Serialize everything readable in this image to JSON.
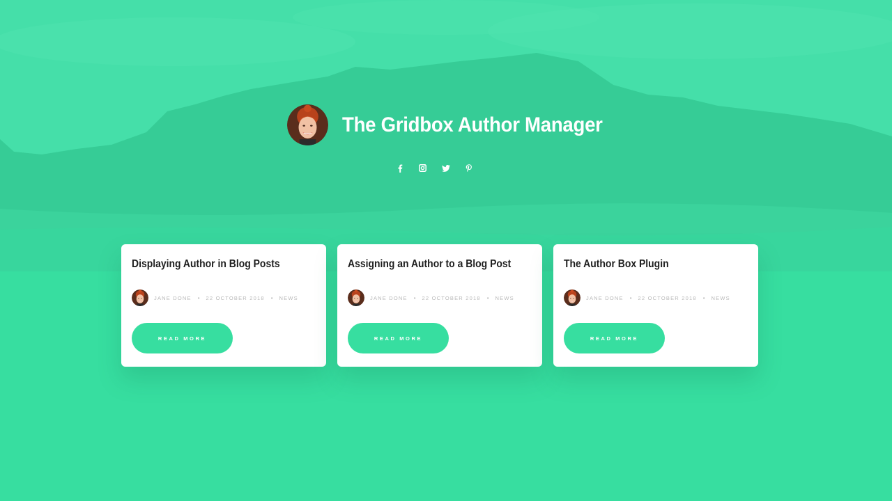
{
  "header": {
    "title": "The Gridbox Author Manager",
    "avatar": "author-avatar"
  },
  "socials": [
    {
      "icon": "facebook-icon",
      "glyph": "f"
    },
    {
      "icon": "instagram-icon"
    },
    {
      "icon": "twitter-icon"
    },
    {
      "icon": "pinterest-icon",
      "glyph": "p"
    }
  ],
  "colors": {
    "accent": "#37dea0",
    "hero": "#3ed8a1",
    "title": "#1e1e1e",
    "meta": "#b9b9b9"
  },
  "posts": [
    {
      "title": "Displaying Author in Blog Posts",
      "author": "JANE DONE",
      "date": "22 OCTOBER 2018",
      "category": "NEWS",
      "button": "READ MORE"
    },
    {
      "title": "Assigning an Author to a Blog Post",
      "author": "JANE DONE",
      "date": "22 OCTOBER 2018",
      "category": "NEWS",
      "button": "READ MORE"
    },
    {
      "title": "The Author Box Plugin",
      "author": "JANE DONE",
      "date": "22 OCTOBER 2018",
      "category": "NEWS",
      "button": "READ MORE"
    }
  ]
}
